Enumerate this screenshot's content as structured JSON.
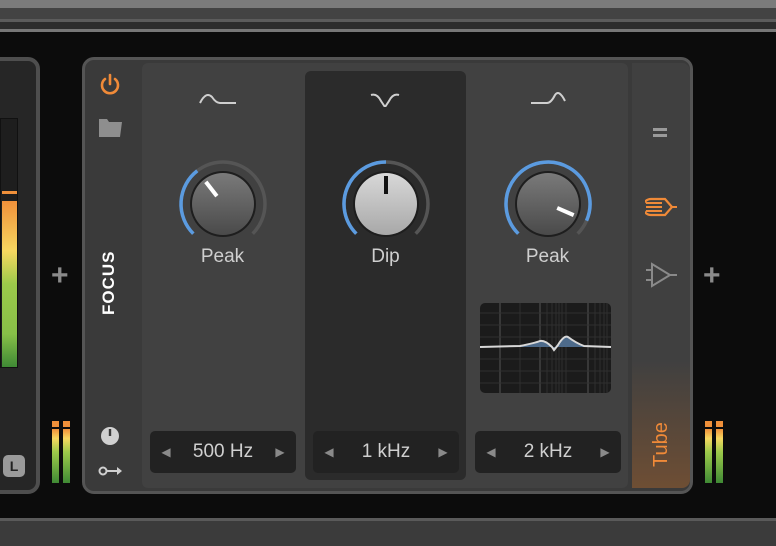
{
  "left_device": {
    "badge": "L"
  },
  "add_buttons": {
    "left": "+",
    "right": "+"
  },
  "device": {
    "name": "FOCUS",
    "icons": [
      "power-icon",
      "folder-icon",
      "clock-icon",
      "key-icon"
    ],
    "bands": [
      {
        "shape_icon": "low-shelf-icon",
        "label": "Peak",
        "value": "500 Hz",
        "knob_level": 0.36,
        "selected": false
      },
      {
        "shape_icon": "notch-icon",
        "label": "Dip",
        "value": "1 kHz",
        "knob_level": 0.5,
        "selected": true
      },
      {
        "shape_icon": "high-shelf-icon",
        "label": "Peak",
        "value": "2 kHz",
        "knob_level": 0.92,
        "selected": false
      }
    ],
    "side_panel": {
      "mode_label": "Tube",
      "icons": [
        "menu-icon",
        "tube-icon",
        "amp-icon"
      ]
    },
    "arrows": {
      "left": "◀",
      "right": "▶"
    }
  },
  "colors": {
    "accent": "#f08a38",
    "knob_arc": "#5b9be0"
  }
}
